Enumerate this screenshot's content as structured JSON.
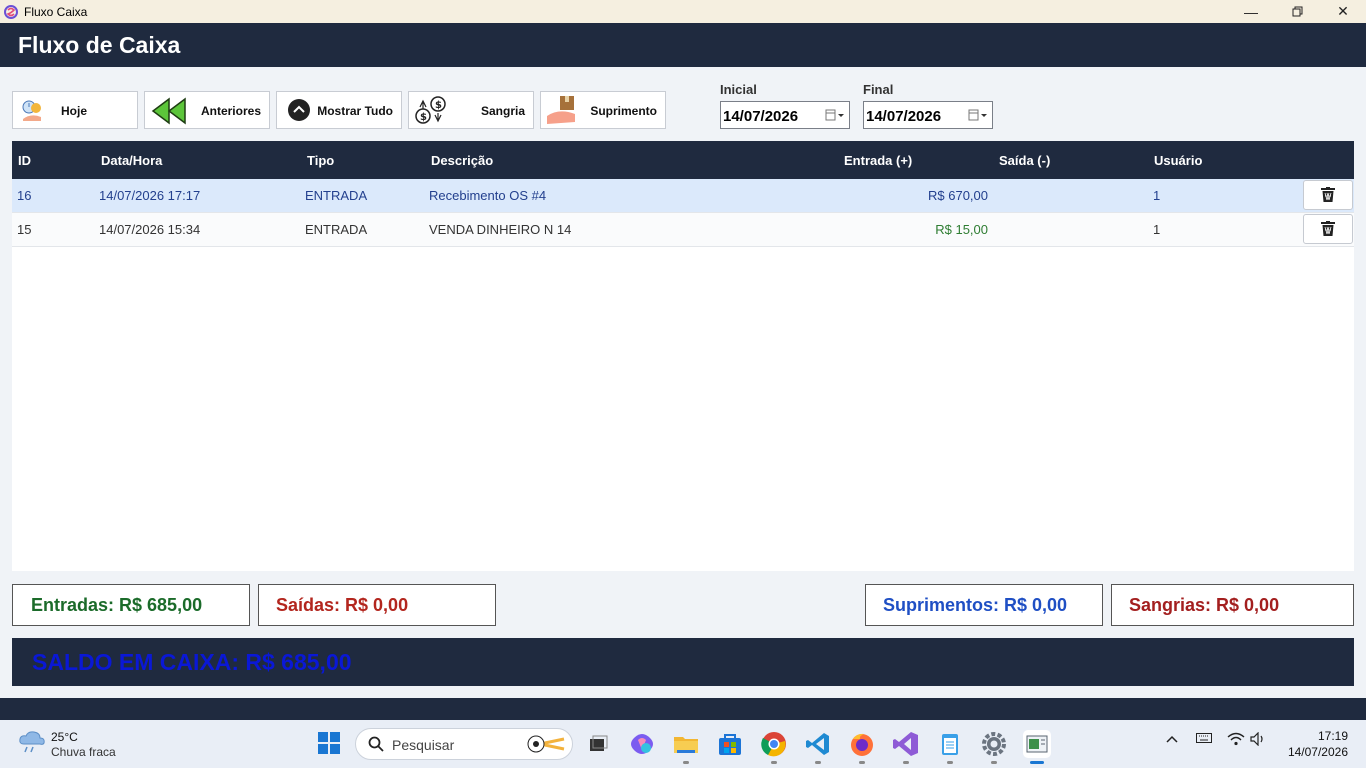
{
  "window": {
    "title": "Fluxo Caixa"
  },
  "header": {
    "title": "Fluxo de Caixa"
  },
  "toolbar": {
    "hoje": "Hoje",
    "anteriores": "Anteriores",
    "mostrar_tudo": "Mostrar Tudo",
    "sangria": "Sangria",
    "suprimento": "Suprimento"
  },
  "dates": {
    "inicial_label": "Inicial",
    "inicial_value": "14/07/2026",
    "final_label": "Final",
    "final_value": "14/07/2026"
  },
  "table": {
    "columns": [
      "ID",
      "Data/Hora",
      "Tipo",
      "Descrição",
      "Entrada (+)",
      "Saída (-)",
      "Usuário"
    ],
    "rows": [
      {
        "id": "16",
        "datahora": "14/07/2026 17:17",
        "tipo": "ENTRADA",
        "descricao": "Recebimento OS #4",
        "entrada": "R$ 670,00",
        "saida": "",
        "usuario": "1"
      },
      {
        "id": "15",
        "datahora": "14/07/2026 15:34",
        "tipo": "ENTRADA",
        "descricao": "VENDA DINHEIRO N 14",
        "entrada": "R$ 15,00",
        "saida": "",
        "usuario": "1"
      }
    ]
  },
  "summary": {
    "entradas": "Entradas: R$ 685,00",
    "saidas": "Saídas: R$ 0,00",
    "suprimentos": "Suprimentos: R$ 0,00",
    "sangrias": "Sangrias: R$ 0,00",
    "saldo": "SALDO EM CAIXA: R$ 685,00"
  },
  "colors": {
    "header_bg": "#1f2a3f",
    "entradas": "#1b6b2a",
    "saidas": "#b3261e",
    "suprimentos": "#1f4fc4",
    "sangrias": "#a31f1f",
    "saldo": "#0a18d6"
  },
  "taskbar": {
    "temperature": "25°C",
    "weather": "Chuva fraca",
    "search_placeholder": "Pesquisar",
    "time": "17:19",
    "date": "14/07/2026"
  }
}
